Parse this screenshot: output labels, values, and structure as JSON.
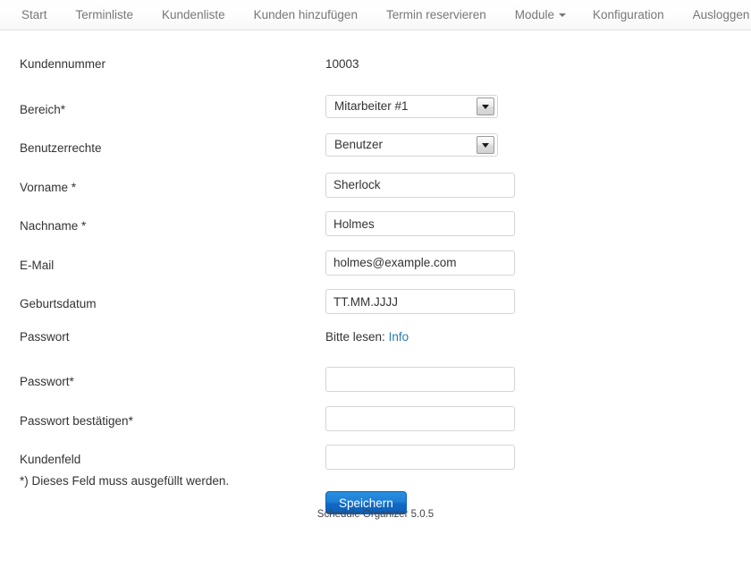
{
  "nav": {
    "items": [
      {
        "label": "Start",
        "has_caret": false
      },
      {
        "label": "Terminliste",
        "has_caret": false
      },
      {
        "label": "Kundenliste",
        "has_caret": false
      },
      {
        "label": "Kunden hinzufügen",
        "has_caret": false
      },
      {
        "label": "Termin reservieren",
        "has_caret": false
      },
      {
        "label": "Module",
        "has_caret": true
      },
      {
        "label": "Konfiguration",
        "has_caret": false
      },
      {
        "label": "Ausloggen",
        "has_caret": false
      }
    ]
  },
  "form": {
    "rows": [
      {
        "label": "Kundennummer",
        "type": "static",
        "value": "10003"
      },
      {
        "label": "Bereich*",
        "type": "select",
        "value": "Mitarbeiter #1"
      },
      {
        "label": "Benutzerrechte",
        "type": "select",
        "value": "Benutzer"
      },
      {
        "label": "Vorname *",
        "type": "text",
        "value": "Sherlock"
      },
      {
        "label": "Nachname *",
        "type": "text",
        "value": "Holmes"
      },
      {
        "label": "E-Mail",
        "type": "text",
        "value": "holmes@example.com"
      },
      {
        "label": "Geburtsdatum",
        "type": "text",
        "value": "TT.MM.JJJJ"
      },
      {
        "label": "Passwort",
        "type": "info",
        "value": "Bitte lesen:",
        "link": "Info"
      },
      {
        "label": "Passwort*",
        "type": "password",
        "value": ""
      },
      {
        "label": "Passwort bestätigen*",
        "type": "password",
        "value": ""
      },
      {
        "label": "Kundenfeld",
        "type": "text",
        "value": ""
      }
    ],
    "save_label": "Speichern",
    "required_note": "*) Dieses Feld muss ausgefüllt werden."
  },
  "footer": {
    "text": "Schedule Organizer 5.0.5"
  },
  "colors": {
    "accent": "#1f7fd4",
    "link": "#2a7ab0",
    "nav_text": "#777777",
    "body_text": "#333333"
  }
}
